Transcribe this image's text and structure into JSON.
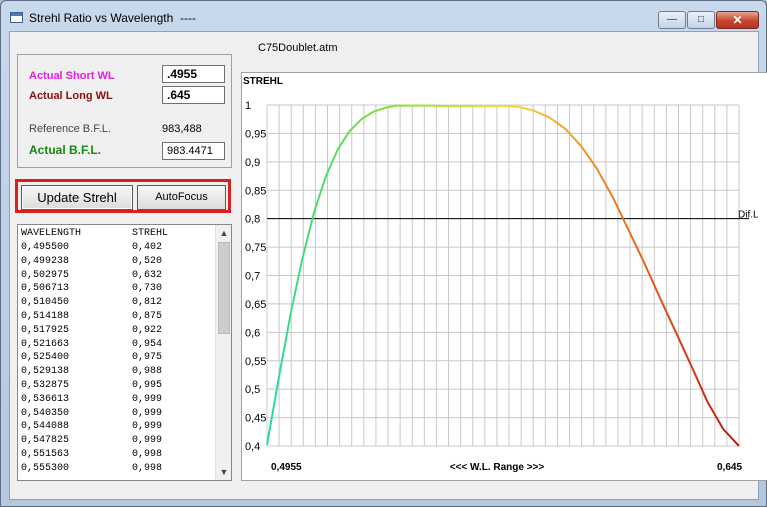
{
  "window": {
    "title": "Strehl Ratio vs Wavelength  ----",
    "buttons": {
      "minimize": "—",
      "maximize": "□",
      "close": "✕"
    }
  },
  "file_name": "C75Doublet.atm",
  "wavelength_panel": {
    "short_label": "Actual Short WL",
    "short_value": ".4955",
    "long_label": "Actual Long WL",
    "long_value": ".645",
    "reference_label": "Reference   B.F.L.",
    "reference_value": "983,488",
    "actual_label": "Actual   B.F.L.",
    "actual_value": "983.4471"
  },
  "buttons": {
    "update": "Update Strehl",
    "autofocus": "AutoFocus"
  },
  "table": {
    "headers": [
      "WAVELENGTH",
      "STREHL"
    ],
    "rows": [
      [
        "0,495500",
        "0,402"
      ],
      [
        "0,499238",
        "0,520"
      ],
      [
        "0,502975",
        "0,632"
      ],
      [
        "0,506713",
        "0,730"
      ],
      [
        "0,510450",
        "0,812"
      ],
      [
        "0,514188",
        "0,875"
      ],
      [
        "0,517925",
        "0,922"
      ],
      [
        "0,521663",
        "0,954"
      ],
      [
        "0,525400",
        "0,975"
      ],
      [
        "0,529138",
        "0,988"
      ],
      [
        "0,532875",
        "0,995"
      ],
      [
        "0,536613",
        "0,999"
      ],
      [
        "0,540350",
        "0,999"
      ],
      [
        "0,544088",
        "0,999"
      ],
      [
        "0,547825",
        "0,999"
      ],
      [
        "0,551563",
        "0,998"
      ],
      [
        "0,555300",
        "0,998"
      ]
    ]
  },
  "scrollbar": {
    "up": "▲",
    "down": "▼"
  },
  "colors": {
    "curve_start": "#2ad8a0",
    "curve_green": "#7fe030",
    "curve_yellow": "#f0e040",
    "curve_orange": "#f08020",
    "curve_end": "#c01010",
    "grid": "#c8c8c8"
  },
  "chart_data": {
    "type": "line",
    "ylabel": "STREHL",
    "xlabel": "<<<   W.L. Range   >>>",
    "x_tick_labels": [
      "0,4955",
      "0,645"
    ],
    "xlim": [
      0.4955,
      0.645
    ],
    "ylim": [
      0.4,
      1.0
    ],
    "y_ticks": [
      {
        "value": 1.0,
        "label": "1"
      },
      {
        "value": 0.95,
        "label": "0,95"
      },
      {
        "value": 0.9,
        "label": "0,9"
      },
      {
        "value": 0.85,
        "label": "0,85"
      },
      {
        "value": 0.8,
        "label": "0,8"
      },
      {
        "value": 0.75,
        "label": "0,75"
      },
      {
        "value": 0.7,
        "label": "0,7"
      },
      {
        "value": 0.65,
        "label": "0,65"
      },
      {
        "value": 0.6,
        "label": "0,6"
      },
      {
        "value": 0.55,
        "label": "0,55"
      },
      {
        "value": 0.5,
        "label": "0,5"
      },
      {
        "value": 0.45,
        "label": "0,45"
      },
      {
        "value": 0.4,
        "label": "0,4"
      }
    ],
    "reference_line": {
      "value": 0.8,
      "label": "Dif.L"
    },
    "grid": true,
    "vertical_grid_lines": 39,
    "series": [
      {
        "x": [
          0.4955,
          0.49924,
          0.50298,
          0.50671,
          0.51045,
          0.51419,
          0.51793,
          0.52166,
          0.5254,
          0.52914,
          0.53288,
          0.53661,
          0.54035,
          0.54409,
          0.54783,
          0.55156,
          0.5553,
          0.56,
          0.565,
          0.57,
          0.575,
          0.58,
          0.585,
          0.59,
          0.595,
          0.6,
          0.605,
          0.61,
          0.615,
          0.62,
          0.625,
          0.63,
          0.635,
          0.64,
          0.645
        ],
        "y": [
          0.402,
          0.52,
          0.632,
          0.73,
          0.812,
          0.875,
          0.922,
          0.954,
          0.975,
          0.988,
          0.995,
          0.999,
          0.999,
          0.999,
          0.999,
          0.998,
          0.998,
          0.998,
          0.998,
          0.998,
          0.997,
          0.99,
          0.978,
          0.958,
          0.928,
          0.888,
          0.838,
          0.78,
          0.722,
          0.66,
          0.6,
          0.54,
          0.478,
          0.43,
          0.4
        ]
      }
    ]
  }
}
